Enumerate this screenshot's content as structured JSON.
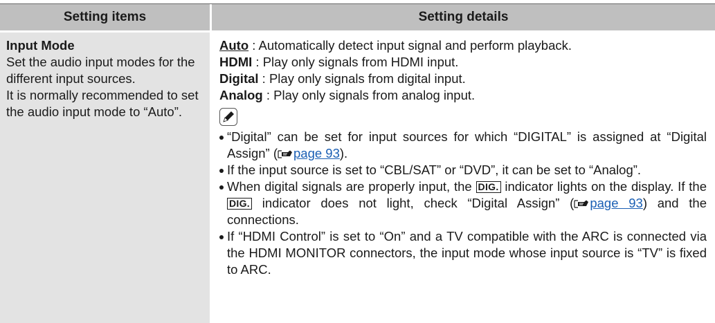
{
  "table": {
    "header_left": "Setting items",
    "header_right": "Setting details"
  },
  "setting": {
    "title": "Input Mode",
    "description": "Set the audio input modes for the different input sources.",
    "recommendation": "It is normally recommended to set the audio input mode to “Auto”."
  },
  "options": [
    {
      "name": "Auto",
      "separator": " : ",
      "desc": "Automatically detect input signal and perform playback.",
      "default": true
    },
    {
      "name": "HDMI",
      "separator": " : ",
      "desc": "Play only signals from HDMI input.",
      "default": false
    },
    {
      "name": "Digital",
      "separator": " : ",
      "desc": "Play only signals from digital input.",
      "default": false
    },
    {
      "name": "Analog",
      "separator": " : ",
      "desc": "Play only signals from analog input.",
      "default": false
    }
  ],
  "note_icon": "pencil-note-icon",
  "notes": {
    "n1_text": "“Digital” can be set for input sources for which “DIGITAL” is assigned at “Digital Assign” (",
    "n1_link": "page 93",
    "n1_end": ").",
    "n2_text": "If the input source is set to “CBL/SAT” or “DVD”, it can be set to “Analog”.",
    "n3_a": "When digital signals are properly input, the ",
    "n3_badge": "DIG.",
    "n3_b": " indicator lights on the display. If the ",
    "n3_c": " indicator does not light, check “Digital Assign” (",
    "n3_link": "page 93",
    "n3_d": ") and the connections.",
    "n4_text": "If “HDMI Control” is set to “On” and a TV compatible with the ARC is connected via the HDMI MONITOR connectors, the input mode whose input source is “TV” is fixed to ARC."
  },
  "colors": {
    "header_bg": "#bfbfbf",
    "left_col_bg": "#e3e3e3",
    "link": "#1a5fb4"
  }
}
